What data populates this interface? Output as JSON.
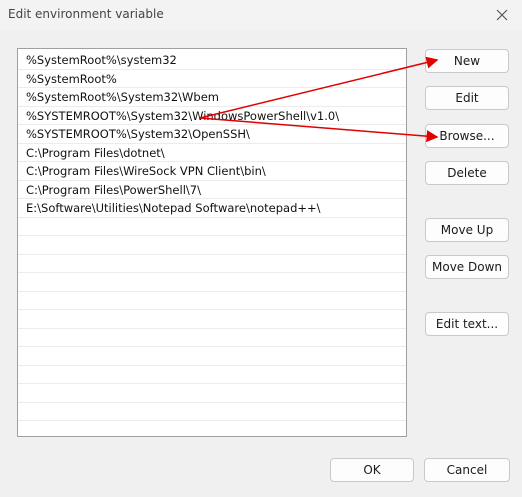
{
  "window": {
    "title": "Edit environment variable",
    "close_icon": "close-icon"
  },
  "paths": [
    "%SystemRoot%\\system32",
    "%SystemRoot%",
    "%SystemRoot%\\System32\\Wbem",
    "%SYSTEMROOT%\\System32\\WindowsPowerShell\\v1.0\\",
    "%SYSTEMROOT%\\System32\\OpenSSH\\",
    "C:\\Program Files\\dotnet\\",
    "C:\\Program Files\\WireSock VPN Client\\bin\\",
    "C:\\Program Files\\PowerShell\\7\\",
    "E:\\Software\\Utilities\\Notepad Software\\notepad++\\",
    "",
    "",
    "",
    "",
    "",
    "",
    "",
    "",
    "",
    "",
    "",
    ""
  ],
  "buttons": {
    "new": "New",
    "edit": "Edit",
    "browse": "Browse...",
    "delete": "Delete",
    "move_up": "Move Up",
    "move_down": "Move Down",
    "edit_text": "Edit text...",
    "ok": "OK",
    "cancel": "Cancel"
  },
  "annotation": {
    "arrow_color": "#e00000"
  }
}
